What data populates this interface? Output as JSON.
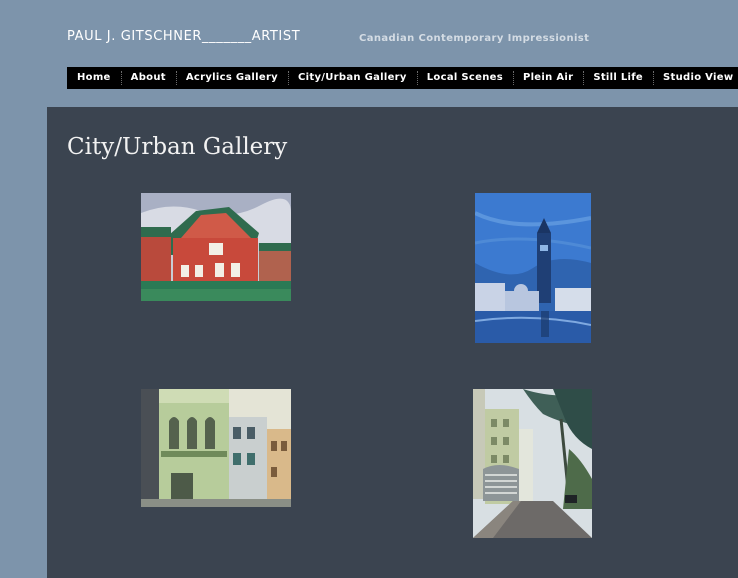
{
  "header": {
    "title": "PAUL J. GITSCHNER_______ARTIST",
    "tagline": "Canadian Contemporary Impressionist"
  },
  "nav": {
    "items": [
      {
        "label": "Home"
      },
      {
        "label": "About"
      },
      {
        "label": "Acrylics Gallery"
      },
      {
        "label": "City/Urban Gallery"
      },
      {
        "label": "Local Scenes"
      },
      {
        "label": "Plein Air"
      },
      {
        "label": "Still Life"
      },
      {
        "label": "Studio View"
      }
    ]
  },
  "main": {
    "page_title": "City/Urban Gallery"
  },
  "colors": {
    "page_background": "#7d94ab",
    "content_background": "#3b4450",
    "nav_background": "#000000",
    "nav_text": "#ffffff"
  }
}
